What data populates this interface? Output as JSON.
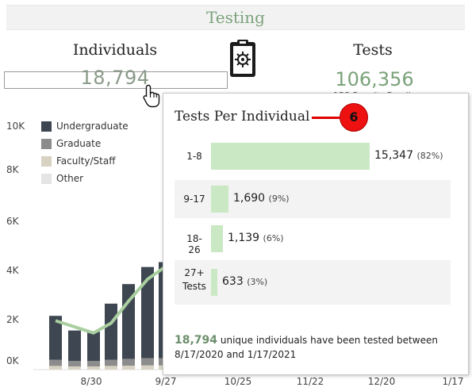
{
  "header": {
    "title": "Testing"
  },
  "kpis": {
    "individuals_label": "Individuals",
    "individuals_value": "18,794",
    "clipboard_icon": "clipboard-icon",
    "tests_label": "Tests",
    "tests_value": "106,356",
    "tests_sub": "158 Results Pending"
  },
  "chart_data": {
    "type": "bar",
    "y_ticks": [
      "10K",
      "8K",
      "6K",
      "4K",
      "2K",
      "0K"
    ],
    "x_ticks": [
      "8/30",
      "9/27",
      "10/25",
      "11/22",
      "12/20",
      "1/17"
    ],
    "ylim": [
      0,
      10000
    ],
    "legend": [
      "Undergraduate",
      "Graduate",
      "Faculty/Staff",
      "Other"
    ],
    "colors": {
      "Undergraduate": "#3d4651",
      "Graduate": "#8c8c8c",
      "Faculty/Staff": "#d8d2c2",
      "Other": "#e4e4e4",
      "line": "#a9cfa0"
    },
    "visible_bars": [
      {
        "total": 2200,
        "graduate": 250,
        "faculty_staff": 150
      },
      {
        "total": 1600,
        "graduate": 220,
        "faculty_staff": 130
      },
      {
        "total": 1550,
        "graduate": 220,
        "faculty_staff": 130
      },
      {
        "total": 2700,
        "graduate": 250,
        "faculty_staff": 150
      },
      {
        "total": 3500,
        "graduate": 280,
        "faculty_staff": 160
      },
      {
        "total": 4200,
        "graduate": 300,
        "faculty_staff": 170
      },
      {
        "total": 4400,
        "graduate": 300,
        "faculty_staff": 170
      }
    ],
    "line_values": [
      2000,
      1750,
      1500,
      1900,
      2800,
      3700,
      4200
    ]
  },
  "popup": {
    "title": "Tests Per Individual",
    "callout": "6",
    "rows": [
      {
        "label": "1-8",
        "count": "15,347",
        "pct": "(82%)",
        "fraction": 0.82
      },
      {
        "label": "9-17",
        "count": "1,690",
        "pct": "(9%)",
        "fraction": 0.09
      },
      {
        "label": "18-26",
        "count": "1,139",
        "pct": "(6%)",
        "fraction": 0.06
      },
      {
        "label": "27+ Tests",
        "count": "633",
        "pct": "(3%)",
        "fraction": 0.03
      }
    ],
    "footer_count": "18,794",
    "footer_text": "unique individuals have been tested between 8/17/2020 and 1/17/2021"
  }
}
